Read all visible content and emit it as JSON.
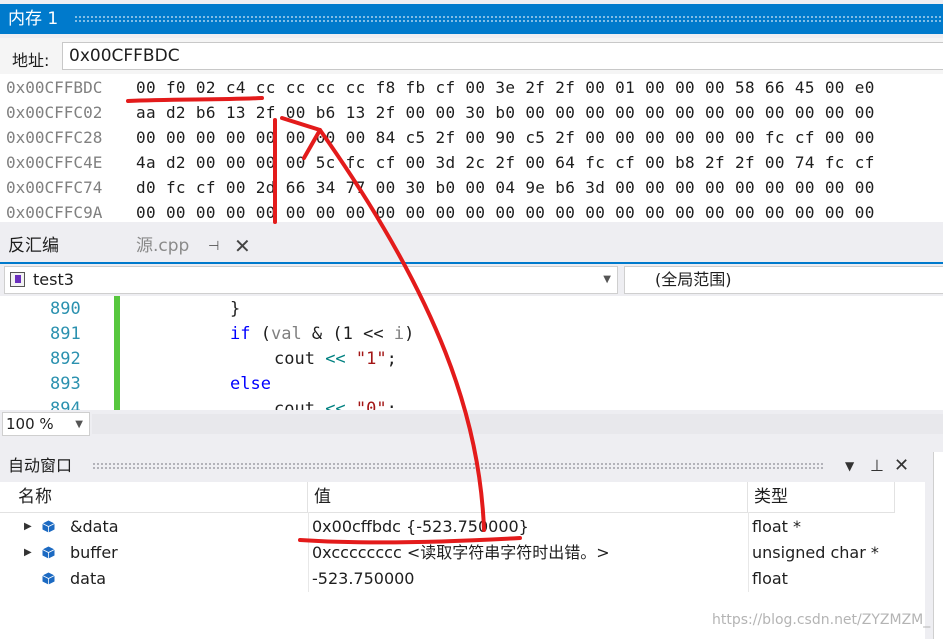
{
  "memory": {
    "title": "内存 1",
    "address_label": "地址:",
    "address_value": "0x00CFFBDC",
    "rows": [
      {
        "addr": "0x00CFFBDC",
        "bytes": "00 f0 02 c4 cc cc cc cc f8 fb cf 00 3e 2f 2f 00 01 00 00 00 58 66 45 00 e0"
      },
      {
        "addr": "0x00CFFC02",
        "bytes": "aa d2 b6 13 2f 00 b6 13 2f 00 00 30 b0 00 00 00 00 00 00 00 00 00 00 00 00"
      },
      {
        "addr": "0x00CFFC28",
        "bytes": "00 00 00 00 00 00 00 00 84 c5 2f 00 90 c5 2f 00 00 00 00 00 00 fc cf 00 00"
      },
      {
        "addr": "0x00CFFC4E",
        "bytes": "4a d2 00 00 00 00 5c fc cf 00 3d 2c 2f 00 64 fc cf 00 b8 2f 2f 00 74 fc cf"
      },
      {
        "addr": "0x00CFFC74",
        "bytes": "d0 fc cf 00 2d 66 34 77 00 30 b0 00 04 9e b6 3d 00 00 00 00 00 00 00 00 00"
      },
      {
        "addr": "0x00CFFC9A",
        "bytes": "00 00 00 00 00 00 00 00 00 00 00 00 00 00 00 00 00 00 00 00 00 00 00 00 00"
      }
    ]
  },
  "tabs": {
    "disasm": "反汇编",
    "source": "源.cpp",
    "pin": "⊣",
    "close": "✕"
  },
  "source_nav": {
    "function": "test3",
    "scope": "(全局范围)"
  },
  "code": {
    "lines": [
      {
        "num": "890",
        "parts": [
          {
            "t": "}",
            "c": ""
          }
        ],
        "indent": 0
      },
      {
        "num": "891",
        "parts": [
          {
            "t": "if",
            "c": "kw"
          },
          {
            "t": " (",
            "c": ""
          },
          {
            "t": "val",
            "c": "id"
          },
          {
            "t": " & (1 << ",
            "c": ""
          },
          {
            "t": "i",
            "c": "id"
          },
          {
            "t": ")",
            "c": ""
          }
        ],
        "indent": 0
      },
      {
        "num": "892",
        "parts": [
          {
            "t": "cout",
            "c": ""
          },
          {
            "t": " << ",
            "c": "op"
          },
          {
            "t": "\"1\"",
            "c": "str"
          },
          {
            "t": ";",
            "c": ""
          }
        ],
        "indent": 1
      },
      {
        "num": "893",
        "parts": [
          {
            "t": "else",
            "c": "kw"
          }
        ],
        "indent": 0
      },
      {
        "num": "894",
        "parts": [
          {
            "t": "cout",
            "c": ""
          },
          {
            "t": " << ",
            "c": "op"
          },
          {
            "t": "\"0\"",
            "c": "str"
          },
          {
            "t": ";",
            "c": ""
          }
        ],
        "indent": 1
      }
    ]
  },
  "zoom": "100 %",
  "autos": {
    "title": "自动窗口",
    "headers": {
      "name": "名称",
      "value": "值",
      "type": "类型"
    },
    "rows": [
      {
        "name": "&data",
        "value": "0x00cffbdc {-523.750000}",
        "type": "float *",
        "expandable": true
      },
      {
        "name": "buffer",
        "value": "0xcccccccc <读取字符串字符时出错。>",
        "type": "unsigned char *",
        "expandable": true
      },
      {
        "name": "data",
        "value": "-523.750000",
        "type": "float",
        "expandable": false
      }
    ]
  },
  "watermark": "https://blog.csdn.net/ZYZMZM_",
  "colors": {
    "accent": "#007acc",
    "annotation": "#e31b1b",
    "variable_icon": "#1c6ac2"
  }
}
